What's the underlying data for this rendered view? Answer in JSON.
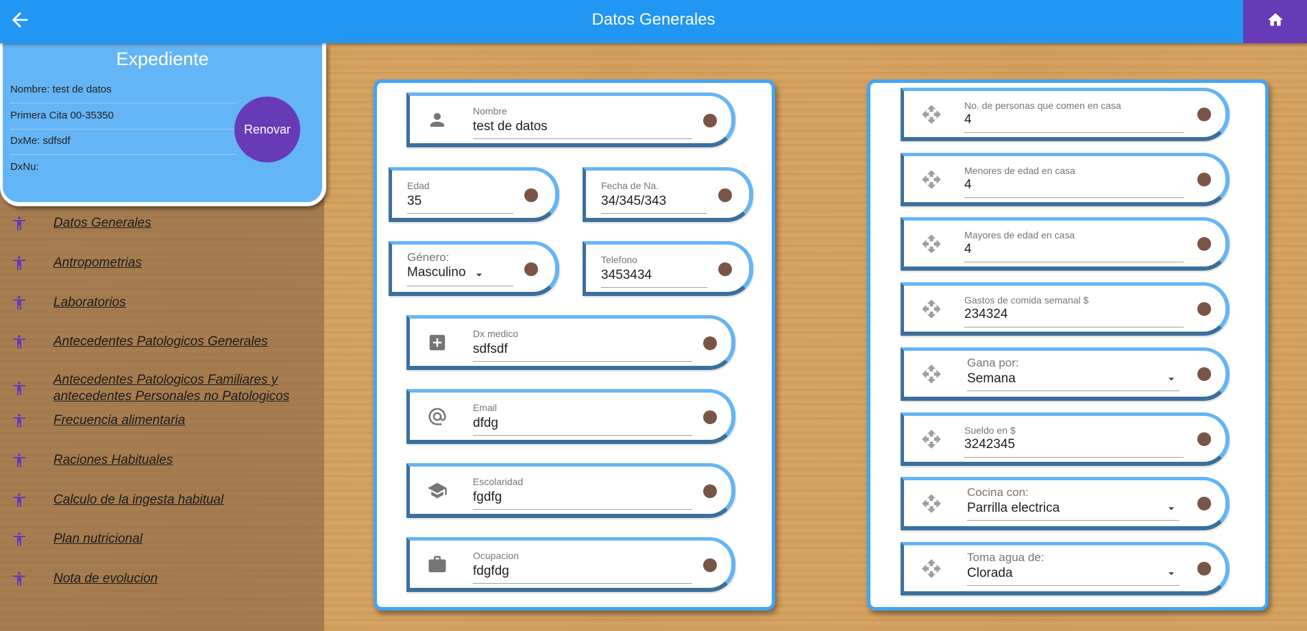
{
  "appbar": {
    "title": "Datos Generales",
    "back_icon": "arrow-back-icon",
    "home_icon": "home-icon",
    "accent": "#2196f3",
    "home_bg": "#673ab7"
  },
  "expediente": {
    "title": "Expediente",
    "nombre": "Nombre: test de datos",
    "primera_cita": "Primera Cita 00-35350",
    "dxme": "DxMe: sdfsdf",
    "dxnu": "DxNu:",
    "renovar": "Renovar"
  },
  "nav": [
    {
      "label": "Datos Generales"
    },
    {
      "label": "Antropometrias"
    },
    {
      "label": "Laboratorios"
    },
    {
      "label": "Antecedentes Patologicos Generales"
    },
    {
      "label": "Antecedentes Patologicos Familiares y antecedentes Personales no Patologicos"
    },
    {
      "label": "Frecuencia alimentaria"
    },
    {
      "label": "Raciones Habituales"
    },
    {
      "label": "Calculo de la ingesta habitual"
    },
    {
      "label": "Plan nutricional"
    },
    {
      "label": "Nota de evolucion"
    }
  ],
  "left_form": {
    "nombre": {
      "label": "Nombre",
      "value": "test de datos",
      "icon": "person-icon"
    },
    "edad": {
      "label": "Edad",
      "value": "35"
    },
    "fecha": {
      "label": "Fecha de Na.",
      "value": "34/345/343"
    },
    "genero": {
      "label": "Género:",
      "value": "Masculino"
    },
    "telefono": {
      "label": "Telefono",
      "value": "3453434"
    },
    "dx_medico": {
      "label": "Dx medico",
      "value": "sdfsdf",
      "icon": "medical-cross-icon"
    },
    "email": {
      "label": "Email",
      "value": "dfdg",
      "icon": "at-icon"
    },
    "escolaridad": {
      "label": "Escolaridad",
      "value": "fgdfg",
      "icon": "school-icon"
    },
    "ocupacion": {
      "label": "Ocupacion",
      "value": "fdgfdg",
      "icon": "briefcase-icon"
    }
  },
  "right_form": {
    "personas": {
      "label": "No. de personas que comen en casa",
      "value": "4"
    },
    "menores": {
      "label": "Menores de edad en casa",
      "value": "4"
    },
    "mayores": {
      "label": "Mayores de edad en casa",
      "value": "4"
    },
    "gastos": {
      "label": "Gastos de comida semanal $",
      "value": "234324"
    },
    "gana_por": {
      "label": "Gana por:",
      "value": "Semana"
    },
    "sueldo": {
      "label": "Sueldo en $",
      "value": "3242345"
    },
    "cocina": {
      "label": "Cocina con:",
      "value": "Parrilla electrica"
    },
    "agua": {
      "label": "Toma agua de:",
      "value": "Clorada"
    }
  }
}
